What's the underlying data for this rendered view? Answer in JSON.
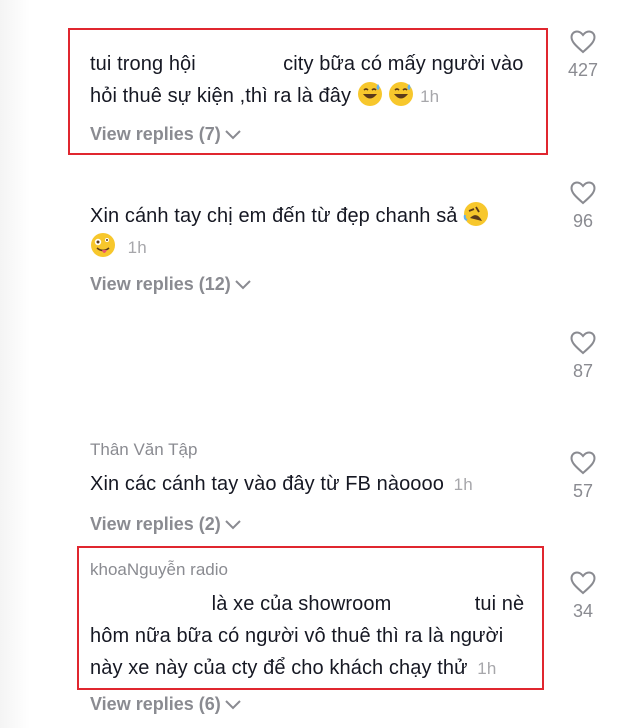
{
  "comments": [
    {
      "line1a": "tui trong hội",
      "line1b": "city bữa có mấy người vào",
      "line2": "hỏi thuê sự kiện ,thì ra là đây",
      "time": "1h",
      "replies": "View replies (7)",
      "likes": "427"
    },
    {
      "line1": "Xin cánh tay chị em đến từ đẹp chanh sả",
      "time": "1h",
      "replies": "View replies (12)",
      "likes": "96"
    },
    {
      "likes": "87"
    },
    {
      "user": "Thân Văn Tập",
      "line1": "Xin các cánh tay vào đây từ FB nàoooo",
      "time": "1h",
      "replies": "View replies (2)",
      "likes": "57"
    },
    {
      "user": "khoaNguyễn radio",
      "line1a": "là xe của showroom",
      "line1b": "tui nè",
      "line2": "hôm nữa bữa có người vô thuê thì ra là người",
      "line3": "này xe này của cty để cho khách chạy thử",
      "time": "1h",
      "replies": "View replies (6)",
      "likes": "34"
    }
  ],
  "colors": {
    "highlight": "#e0262f",
    "secondary": "#8a8b91"
  }
}
